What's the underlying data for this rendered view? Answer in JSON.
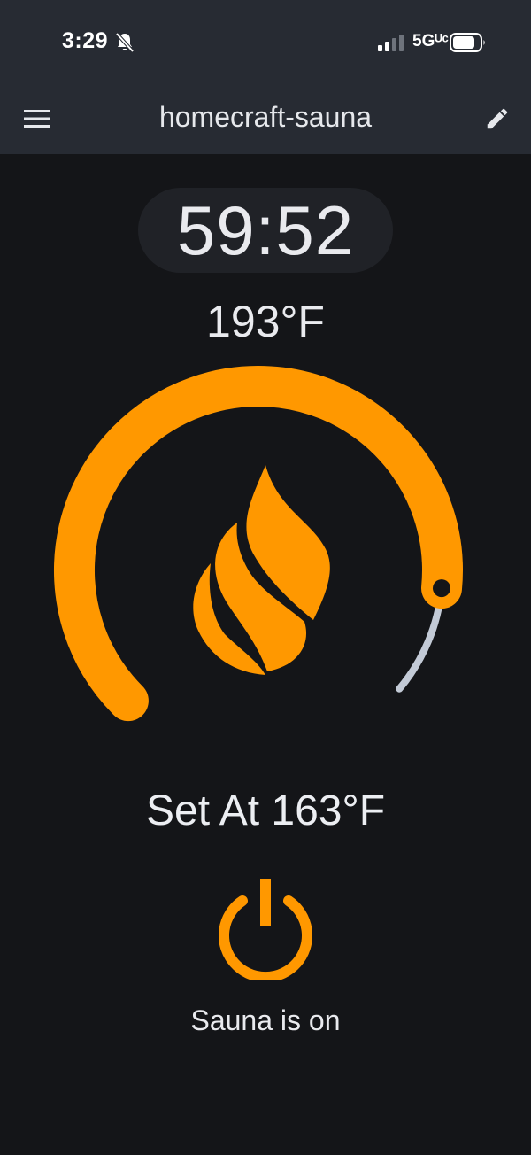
{
  "status_bar": {
    "time": "3:29",
    "network": "5Gᵁᶜ",
    "icons": [
      "bell-slash-icon",
      "signal-icon",
      "battery-icon"
    ]
  },
  "app_bar": {
    "title": "homecraft-sauna",
    "menu_icon": "hamburger-menu-icon",
    "edit_icon": "pencil-icon"
  },
  "sauna": {
    "timer": "59:52",
    "current_temperature": "193°F",
    "set_temperature_label": "Set At 163°F",
    "power_status": "Sauna is on",
    "dial_level": 0.87
  },
  "colors": {
    "accent": "#ff9800",
    "header_bg": "#272b33",
    "background": "#141518",
    "track": "#c3cad6"
  }
}
